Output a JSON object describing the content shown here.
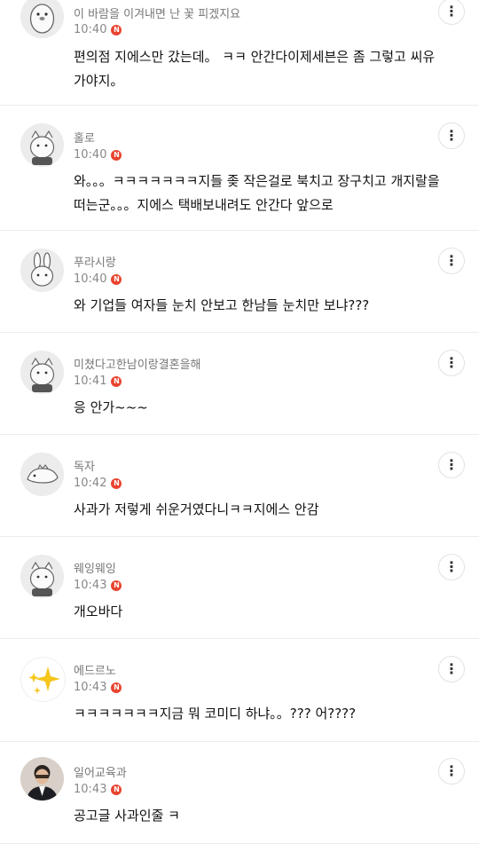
{
  "comments": [
    {
      "nickname": "이 바람을 이겨내면 난 꽃 피겠지요",
      "time": "10:40",
      "badge": "N",
      "text": "편의점 지에스만 갔는데。 ㅋㅋ 안간다이제세븐은 좀 그렇고 씨유가야지。",
      "avatar": "penguin-avatar"
    },
    {
      "nickname": "홀로",
      "time": "10:40",
      "badge": "N",
      "text": "와。。。ㅋㅋㅋㅋㅋㅋㅋ지들 좆 작은걸로 북치고 장구치고 개지랄을 떠는군。。。지에스 택배보내려도 안간다 앞으로",
      "avatar": "cat-avatar"
    },
    {
      "nickname": "푸라시랑",
      "time": "10:40",
      "badge": "N",
      "text": "와 기업들 여자들 눈치 안보고 한남들 눈치만 보냐???",
      "avatar": "rabbit-avatar"
    },
    {
      "nickname": "미쳤다고한남이랑결혼을해",
      "time": "10:41",
      "badge": "N",
      "text": "응 안가~~~",
      "avatar": "cat-avatar"
    },
    {
      "nickname": "독자",
      "time": "10:42",
      "badge": "N",
      "text": "사과가 저렇게 쉬운거였다니ㅋㅋ지에스 안감",
      "avatar": "dino-avatar"
    },
    {
      "nickname": "웨잉웨잉",
      "time": "10:43",
      "badge": "N",
      "text": "개오바다",
      "avatar": "cat-avatar"
    },
    {
      "nickname": "에드르노",
      "time": "10:43",
      "badge": "N",
      "text": "ㅋㅋㅋㅋㅋㅋㅋ지금 뭐 코미디 하냐。。??? 어????",
      "avatar": "sparkle-avatar"
    },
    {
      "nickname": "일어교육과",
      "time": "10:43",
      "badge": "N",
      "text": "공고글 사과인줄 ㅋ",
      "avatar": "photo-avatar"
    }
  ],
  "more_button_glyph": "⋮"
}
